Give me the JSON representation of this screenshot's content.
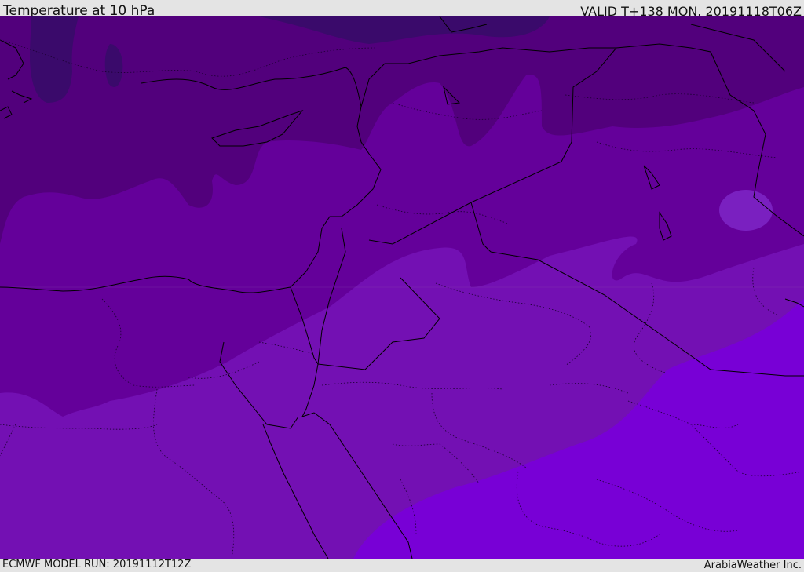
{
  "header": {
    "title": "Temperature at 10 hPa",
    "valid": "VALID T+138 MON. 20191118T06Z"
  },
  "footer": {
    "model_run": "ECMWF MODEL RUN: 20191112T12Z",
    "credit": "ArabiaWeather Inc."
  },
  "map": {
    "field": "temperature",
    "level": "10 hPa",
    "palette": {
      "coldest": "#3a0a6b",
      "very_cold": "#52007c",
      "cold": "#64009a",
      "cool": "#7310b3",
      "mild": "#7800d6",
      "warm_spot": "#7a20c0"
    },
    "border_color": "#000000"
  }
}
